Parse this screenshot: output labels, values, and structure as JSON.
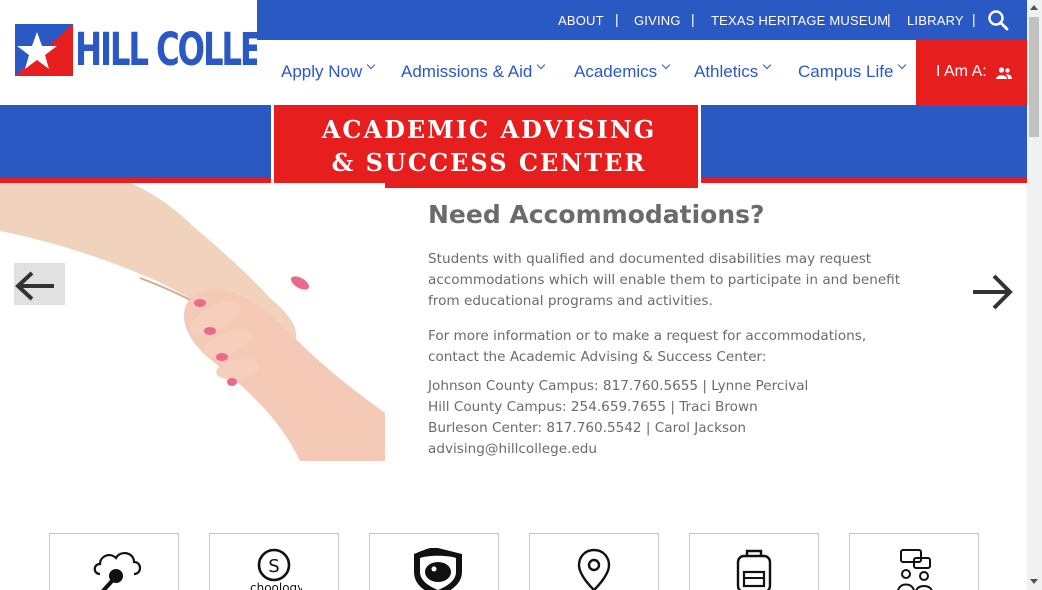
{
  "brand": {
    "name": "HILL COLLEGE",
    "blue": "#2b59c3",
    "red": "#e61e1e"
  },
  "utility_nav": [
    {
      "label": "ABOUT"
    },
    {
      "label": "GIVING"
    },
    {
      "label": "TEXAS HERITAGE MUSEUM"
    },
    {
      "label": "LIBRARY"
    }
  ],
  "utility_separator": "|",
  "main_nav": [
    {
      "label": "Apply Now"
    },
    {
      "label": "Admissions & Aid"
    },
    {
      "label": "Academics"
    },
    {
      "label": "Athletics"
    },
    {
      "label": "Campus Life"
    }
  ],
  "i_am": {
    "label": "I Am A:"
  },
  "hero": {
    "badge_line1": "ACADEMIC ADVISING",
    "badge_line2": "& SUCCESS CENTER",
    "title": "Need Accommodations?",
    "para1_line1": "Students with qualified and documented disabilities may request",
    "para1_line2": "accommodations which will enable them to participate in and benefit",
    "para1_line3": "from educational programs and activities.",
    "para2_line1": "For more information or to make a request for accommodations,",
    "para2_line2": "contact the Academic Advising & Success Center:",
    "contact1": "Johnson County Campus:  817.760.5655 | Lynne Percival",
    "contact2": "Hill County Campus:  254.659.7655 | Traci Brown",
    "contact3": "Burleson Center:  817.760.5542 | Carol Jackson",
    "email": "advising@hillcollege.edu"
  },
  "quick_links": [
    {
      "icon": "key-cloud-icon"
    },
    {
      "icon": "schoology-icon"
    },
    {
      "icon": "mascot-shield-icon"
    },
    {
      "icon": "map-pin-icon"
    },
    {
      "icon": "backpack-icon"
    },
    {
      "icon": "advisor-chat-icon"
    }
  ]
}
